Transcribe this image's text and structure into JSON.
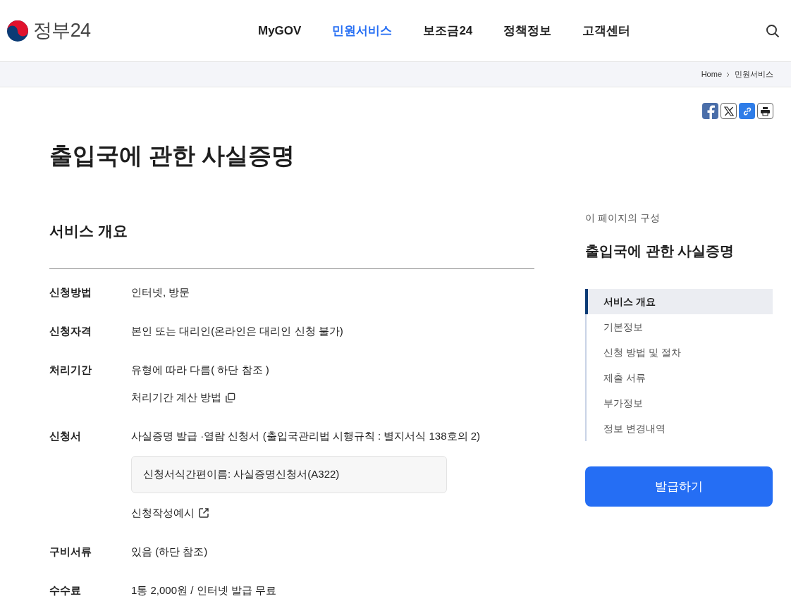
{
  "header": {
    "logo_text": "정부24",
    "nav": [
      {
        "label": "MyGOV",
        "selected": false
      },
      {
        "label": "민원서비스",
        "selected": true
      },
      {
        "label": "보조금24",
        "selected": false
      },
      {
        "label": "정책정보",
        "selected": false
      },
      {
        "label": "고객센터",
        "selected": false
      }
    ]
  },
  "breadcrumb": [
    "Home",
    "민원서비스"
  ],
  "title": "출입국에 관한 사실증명",
  "section_title": "서비스 개요",
  "rows": [
    {
      "label": "신청방법",
      "items": [
        {
          "kind": "text",
          "text": "인터넷, 방문"
        }
      ]
    },
    {
      "label": "신청자격",
      "items": [
        {
          "kind": "text",
          "text": "본인 또는 대리인(온라인은 대리인 신청 불가)"
        }
      ]
    },
    {
      "label": "처리기간",
      "items": [
        {
          "kind": "text",
          "text": "유형에 따라 다름( 하단 참조 )"
        },
        {
          "kind": "popup-link",
          "text": "처리기간 계산 방법"
        }
      ]
    },
    {
      "label": "신청서",
      "items": [
        {
          "kind": "text",
          "text": "사실증명 발급 ·열람 신청서 (출입국관리법 시행규칙 : 별지서식 138호의 2)"
        },
        {
          "kind": "note",
          "text": "신청서식간편이름: 사실증명신청서(A322)"
        },
        {
          "kind": "external-link",
          "text": "신청작성예시"
        }
      ]
    },
    {
      "label": "구비서류",
      "items": [
        {
          "kind": "text",
          "text": "있음 (하단 참조)"
        }
      ]
    },
    {
      "label": "수수료",
      "items": [
        {
          "kind": "text",
          "text": "1통 2,000원 / 인터넷 발급 무료"
        }
      ]
    }
  ],
  "toc": {
    "caption": "이 페이지의 구성",
    "title": "출입국에 관한 사실증명",
    "items": [
      {
        "label": "서비스 개요",
        "selected": true
      },
      {
        "label": "기본정보",
        "selected": false
      },
      {
        "label": "신청 방법 및 절차",
        "selected": false
      },
      {
        "label": "제출 서류",
        "selected": false
      },
      {
        "label": "부가정보",
        "selected": false
      },
      {
        "label": "정보 변경내역",
        "selected": false
      }
    ],
    "button": "발급하기"
  }
}
